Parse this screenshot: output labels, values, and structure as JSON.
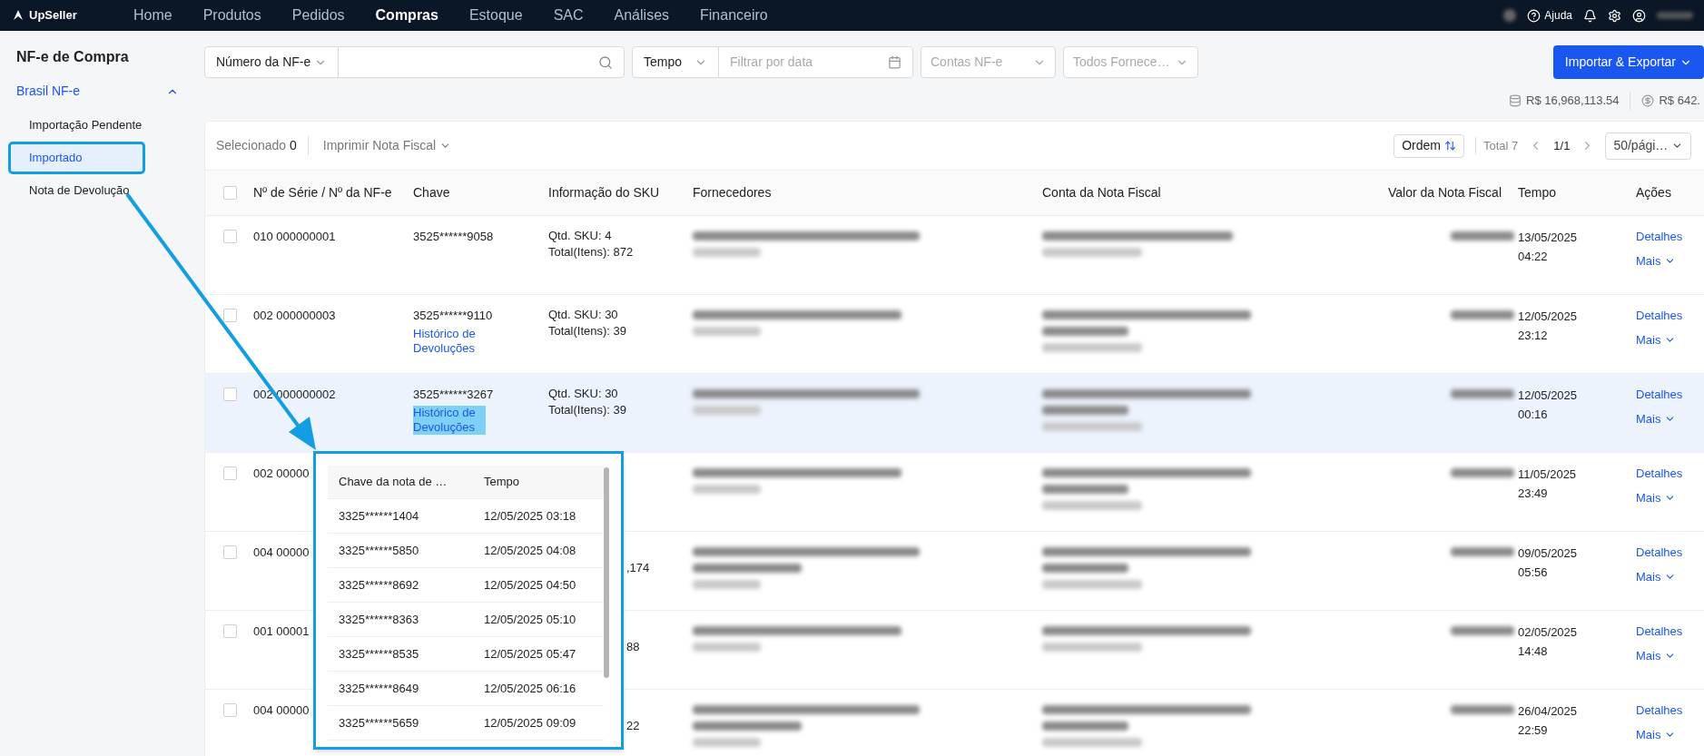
{
  "topbar": {
    "logo": "UpSeller",
    "nav": [
      {
        "label": "Home",
        "selected": false
      },
      {
        "label": "Produtos",
        "selected": false
      },
      {
        "label": "Pedidos",
        "selected": false
      },
      {
        "label": "Compras",
        "selected": true
      },
      {
        "label": "Estoque",
        "selected": false
      },
      {
        "label": "SAC",
        "selected": false
      },
      {
        "label": "Análises",
        "selected": false
      },
      {
        "label": "Financeiro",
        "selected": false
      }
    ],
    "help": "Ajuda"
  },
  "sidebar": {
    "title": "NF-e de Compra",
    "group": {
      "label": "Brasil NF-e",
      "expanded": true
    },
    "items": [
      {
        "label": "Importação Pendente",
        "selected": false,
        "framed": false
      },
      {
        "label": "Importado",
        "selected": true,
        "framed": true
      },
      {
        "label": "Nota de Devolução",
        "selected": false,
        "framed": false
      }
    ]
  },
  "filters": {
    "search_type": "Número da NF-e",
    "time_type": "Tempo",
    "date_placeholder": "Filtrar por data",
    "accounts": "Contas NF-e",
    "suppliers": "Todos Fornece…",
    "import_export": "Importar & Exportar"
  },
  "totals": [
    "R$ 16,968,113.54",
    "R$ 642."
  ],
  "toolbar": {
    "selected_label": "Selecionado",
    "selected_count": "0",
    "print": "Imprimir Nota Fiscal",
    "order": "Ordem",
    "total": "Total 7",
    "page": "1/1",
    "page_size": "50/pági…"
  },
  "table": {
    "header_checked": false,
    "columns": [
      "Nº de Série / Nº da NF-e",
      "Chave",
      "Informação do SKU",
      "Fornecedores",
      "Conta da Nota Fiscal",
      "Valor da Nota Fiscal",
      "Tempo",
      "Ações"
    ],
    "rows": [
      {
        "checked": false,
        "hovered": false,
        "series": "010 000000001",
        "chave": "3525******9058",
        "sku_qty": "Qtd. SKU: 4",
        "sku_total": "Total(Itens): 872",
        "date": "13/05/2025",
        "time": "04:22",
        "details": "Detalhes",
        "more": "Mais"
      },
      {
        "checked": false,
        "hovered": false,
        "series": "002 000000003",
        "chave": "3525******9110",
        "returns_link": {
          "label": "Histórico de Devoluções",
          "annotated": false
        },
        "sku_qty": "Qtd. SKU: 30",
        "sku_total": "Total(Itens): 39",
        "date": "12/05/2025",
        "time": "23:12",
        "details": "Detalhes",
        "more": "Mais"
      },
      {
        "checked": false,
        "hovered": true,
        "series": "002 000000002",
        "chave": "3525******3267",
        "returns_link": {
          "label": "Histórico de Devoluções",
          "annotated": true
        },
        "sku_qty": "Qtd. SKU: 30",
        "sku_total": "Total(Itens): 39",
        "date": "12/05/2025",
        "time": "00:16",
        "details": "Detalhes",
        "more": "Mais"
      },
      {
        "checked": false,
        "hovered": false,
        "series": "002 00000",
        "date": "11/05/2025",
        "time": "23:49",
        "details": "Detalhes",
        "more": "Mais"
      },
      {
        "checked": false,
        "hovered": false,
        "series": "004 00000",
        "sku_total_tail": ",174",
        "date": "09/05/2025",
        "time": "05:56",
        "details": "Detalhes",
        "more": "Mais"
      },
      {
        "checked": false,
        "hovered": false,
        "series": "001 00001",
        "sku_total_tail": "88",
        "date": "02/05/2025",
        "time": "14:48",
        "details": "Detalhes",
        "more": "Mais"
      },
      {
        "checked": false,
        "hovered": false,
        "series": "004 00000",
        "sku_total_tail": "22",
        "date": "26/04/2025",
        "time": "22:59",
        "details": "Detalhes",
        "more": "Mais"
      }
    ]
  },
  "returns_popup": {
    "columns": [
      "Chave da nota de …",
      "Tempo"
    ],
    "rows": [
      {
        "key": "3325******1404",
        "time": "12/05/2025 03:18"
      },
      {
        "key": "3325******5850",
        "time": "12/05/2025 04:08"
      },
      {
        "key": "3325******8692",
        "time": "12/05/2025 04:50"
      },
      {
        "key": "3325******8363",
        "time": "12/05/2025 05:10"
      },
      {
        "key": "3325******8535",
        "time": "12/05/2025 05:47"
      },
      {
        "key": "3325******8649",
        "time": "12/05/2025 06:16"
      },
      {
        "key": "3325******5659",
        "time": "12/05/2025 09:09"
      }
    ]
  }
}
